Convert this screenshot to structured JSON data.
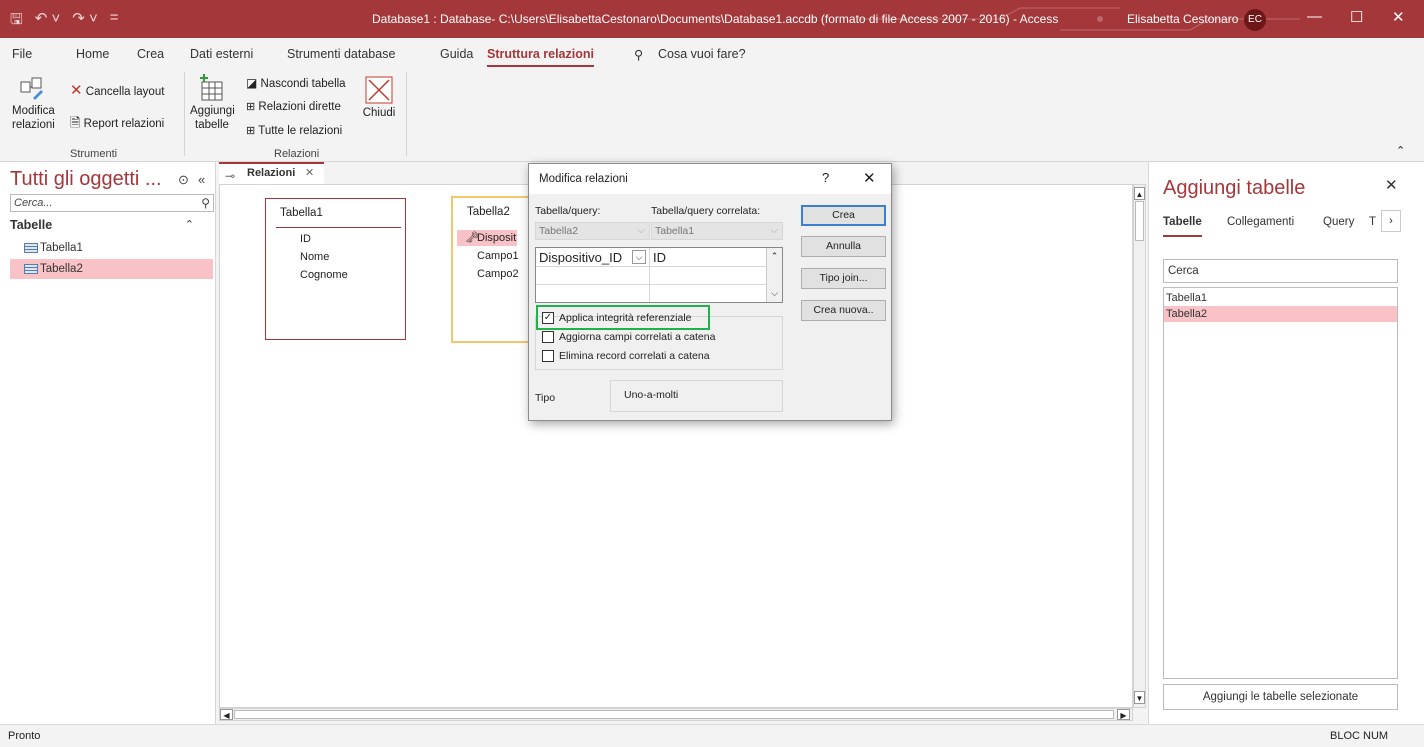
{
  "titlebar": {
    "title": "Database1 : Database- C:\\Users\\ElisabettaCestonaro\\Documents\\Database1.accdb (formato di file Access 2007 - 2016)  -  Access",
    "user": "Elisabetta Cestonaro",
    "avatar": "EC",
    "minimize": "—",
    "maximize": "☐",
    "close": "✕",
    "accent": "#a4373a"
  },
  "menu": {
    "tabs": [
      "File",
      "Home",
      "Crea",
      "Dati esterni",
      "Strumenti database",
      "Guida",
      "Struttura relazioni"
    ],
    "active": "Struttura relazioni",
    "tell_me": "Cosa vuoi fare?"
  },
  "ribbon": {
    "modifica_relazioni": "Modifica\nrelazioni",
    "cancella_layout": "Cancella layout",
    "report_relazioni": "Report relazioni",
    "strumenti_label": "Strumenti",
    "aggiungi_tabelle": "Aggiungi\ntabelle",
    "nascondi_tabella": "Nascondi tabella",
    "relazioni_dirette": "Relazioni dirette",
    "tutte_relazioni": "Tutte le relazioni",
    "chiudi": "Chiudi",
    "relazioni_label": "Relazioni"
  },
  "nav": {
    "title": "Tutti gli oggetti ...",
    "search_placeholder": "Cerca...",
    "section": "Tabelle",
    "items": [
      {
        "label": "Tabella1",
        "selected": false
      },
      {
        "label": "Tabella2",
        "selected": true
      }
    ]
  },
  "document": {
    "tab_label": "Relazioni",
    "tables": [
      {
        "name": "Tabella1",
        "fields": [
          "ID",
          "Nome",
          "Cognome"
        ]
      },
      {
        "name": "Tabella2",
        "fields": [
          "Disposit",
          "Campo1",
          "Campo2"
        ]
      }
    ]
  },
  "dialog": {
    "title": "Modifica relazioni",
    "help": "?",
    "close": "✕",
    "table_query_label": "Tabella/query:",
    "related_label": "Tabella/query correlata:",
    "table_query_value": "Tabella2",
    "related_value": "Tabella1",
    "grid": [
      {
        "left": "Dispositivo_ID",
        "right": "ID"
      },
      {
        "left": "",
        "right": ""
      },
      {
        "left": "",
        "right": ""
      }
    ],
    "enforce_integrity": {
      "label": "Applica integrità referenziale",
      "checked": true
    },
    "cascade_update": {
      "label": "Aggiorna campi correlati a catena",
      "checked": false
    },
    "cascade_delete": {
      "label": "Elimina record correlati a catena",
      "checked": false
    },
    "tipo_label": "Tipo",
    "tipo_value": "Uno-a-molti",
    "buttons": {
      "crea": "Crea",
      "annulla": "Annulla",
      "tipo_join": "Tipo join...",
      "crea_nuova": "Crea nuova.."
    }
  },
  "right_pane": {
    "title": "Aggiungi tabelle",
    "close": "✕",
    "tabs": [
      "Tabelle",
      "Collegamenti",
      "Query",
      "T"
    ],
    "search_placeholder": "Cerca",
    "items": [
      {
        "label": "Tabella1",
        "selected": false
      },
      {
        "label": "Tabella2",
        "selected": true
      }
    ],
    "add_button": "Aggiungi le tabelle selezionate"
  },
  "status": {
    "left": "Pronto",
    "right": "BLOC NUM"
  }
}
